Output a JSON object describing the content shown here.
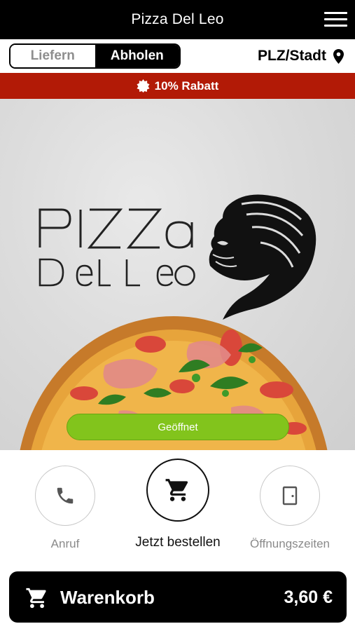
{
  "header": {
    "title": "Pizza Del Leo",
    "menu_icon": "hamburger-menu-icon"
  },
  "order_mode": {
    "options": [
      {
        "label": "Liefern",
        "selected": false
      },
      {
        "label": "Abholen",
        "selected": true
      }
    ]
  },
  "location": {
    "label": "PLZ/Stadt",
    "icon": "map-pin-icon"
  },
  "banner": {
    "text": "10% Rabatt",
    "icon": "badge-icon",
    "color": "#b21a06"
  },
  "hero": {
    "logo_text": "Pizza Del Leo",
    "status_label": "Geöffnet",
    "status_color": "#82c41c"
  },
  "actions": [
    {
      "label": "Anruf",
      "icon": "phone-icon"
    },
    {
      "label": "Jetzt bestellen",
      "icon": "cart-icon"
    },
    {
      "label": "Öffnungszeiten",
      "icon": "door-icon"
    }
  ],
  "cart": {
    "label": "Warenkorb",
    "total": "3,60 €",
    "icon": "cart-icon"
  }
}
